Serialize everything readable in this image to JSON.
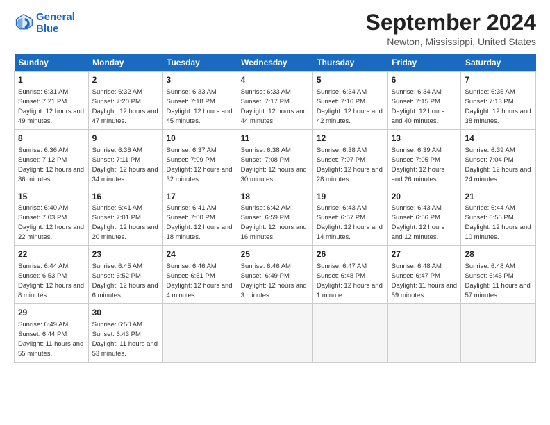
{
  "header": {
    "logo_line1": "General",
    "logo_line2": "Blue",
    "month_title": "September 2024",
    "location": "Newton, Mississippi, United States"
  },
  "days_of_week": [
    "Sunday",
    "Monday",
    "Tuesday",
    "Wednesday",
    "Thursday",
    "Friday",
    "Saturday"
  ],
  "weeks": [
    [
      {
        "day": "1",
        "sunrise": "6:31 AM",
        "sunset": "7:21 PM",
        "daylight": "12 hours and 49 minutes."
      },
      {
        "day": "2",
        "sunrise": "6:32 AM",
        "sunset": "7:20 PM",
        "daylight": "12 hours and 47 minutes."
      },
      {
        "day": "3",
        "sunrise": "6:33 AM",
        "sunset": "7:18 PM",
        "daylight": "12 hours and 45 minutes."
      },
      {
        "day": "4",
        "sunrise": "6:33 AM",
        "sunset": "7:17 PM",
        "daylight": "12 hours and 44 minutes."
      },
      {
        "day": "5",
        "sunrise": "6:34 AM",
        "sunset": "7:16 PM",
        "daylight": "12 hours and 42 minutes."
      },
      {
        "day": "6",
        "sunrise": "6:34 AM",
        "sunset": "7:15 PM",
        "daylight": "12 hours and 40 minutes."
      },
      {
        "day": "7",
        "sunrise": "6:35 AM",
        "sunset": "7:13 PM",
        "daylight": "12 hours and 38 minutes."
      }
    ],
    [
      {
        "day": "8",
        "sunrise": "6:36 AM",
        "sunset": "7:12 PM",
        "daylight": "12 hours and 36 minutes."
      },
      {
        "day": "9",
        "sunrise": "6:36 AM",
        "sunset": "7:11 PM",
        "daylight": "12 hours and 34 minutes."
      },
      {
        "day": "10",
        "sunrise": "6:37 AM",
        "sunset": "7:09 PM",
        "daylight": "12 hours and 32 minutes."
      },
      {
        "day": "11",
        "sunrise": "6:38 AM",
        "sunset": "7:08 PM",
        "daylight": "12 hours and 30 minutes."
      },
      {
        "day": "12",
        "sunrise": "6:38 AM",
        "sunset": "7:07 PM",
        "daylight": "12 hours and 28 minutes."
      },
      {
        "day": "13",
        "sunrise": "6:39 AM",
        "sunset": "7:05 PM",
        "daylight": "12 hours and 26 minutes."
      },
      {
        "day": "14",
        "sunrise": "6:39 AM",
        "sunset": "7:04 PM",
        "daylight": "12 hours and 24 minutes."
      }
    ],
    [
      {
        "day": "15",
        "sunrise": "6:40 AM",
        "sunset": "7:03 PM",
        "daylight": "12 hours and 22 minutes."
      },
      {
        "day": "16",
        "sunrise": "6:41 AM",
        "sunset": "7:01 PM",
        "daylight": "12 hours and 20 minutes."
      },
      {
        "day": "17",
        "sunrise": "6:41 AM",
        "sunset": "7:00 PM",
        "daylight": "12 hours and 18 minutes."
      },
      {
        "day": "18",
        "sunrise": "6:42 AM",
        "sunset": "6:59 PM",
        "daylight": "12 hours and 16 minutes."
      },
      {
        "day": "19",
        "sunrise": "6:43 AM",
        "sunset": "6:57 PM",
        "daylight": "12 hours and 14 minutes."
      },
      {
        "day": "20",
        "sunrise": "6:43 AM",
        "sunset": "6:56 PM",
        "daylight": "12 hours and 12 minutes."
      },
      {
        "day": "21",
        "sunrise": "6:44 AM",
        "sunset": "6:55 PM",
        "daylight": "12 hours and 10 minutes."
      }
    ],
    [
      {
        "day": "22",
        "sunrise": "6:44 AM",
        "sunset": "6:53 PM",
        "daylight": "12 hours and 8 minutes."
      },
      {
        "day": "23",
        "sunrise": "6:45 AM",
        "sunset": "6:52 PM",
        "daylight": "12 hours and 6 minutes."
      },
      {
        "day": "24",
        "sunrise": "6:46 AM",
        "sunset": "6:51 PM",
        "daylight": "12 hours and 4 minutes."
      },
      {
        "day": "25",
        "sunrise": "6:46 AM",
        "sunset": "6:49 PM",
        "daylight": "12 hours and 3 minutes."
      },
      {
        "day": "26",
        "sunrise": "6:47 AM",
        "sunset": "6:48 PM",
        "daylight": "12 hours and 1 minute."
      },
      {
        "day": "27",
        "sunrise": "6:48 AM",
        "sunset": "6:47 PM",
        "daylight": "11 hours and 59 minutes."
      },
      {
        "day": "28",
        "sunrise": "6:48 AM",
        "sunset": "6:45 PM",
        "daylight": "11 hours and 57 minutes."
      }
    ],
    [
      {
        "day": "29",
        "sunrise": "6:49 AM",
        "sunset": "6:44 PM",
        "daylight": "11 hours and 55 minutes."
      },
      {
        "day": "30",
        "sunrise": "6:50 AM",
        "sunset": "6:43 PM",
        "daylight": "11 hours and 53 minutes."
      },
      null,
      null,
      null,
      null,
      null
    ]
  ]
}
